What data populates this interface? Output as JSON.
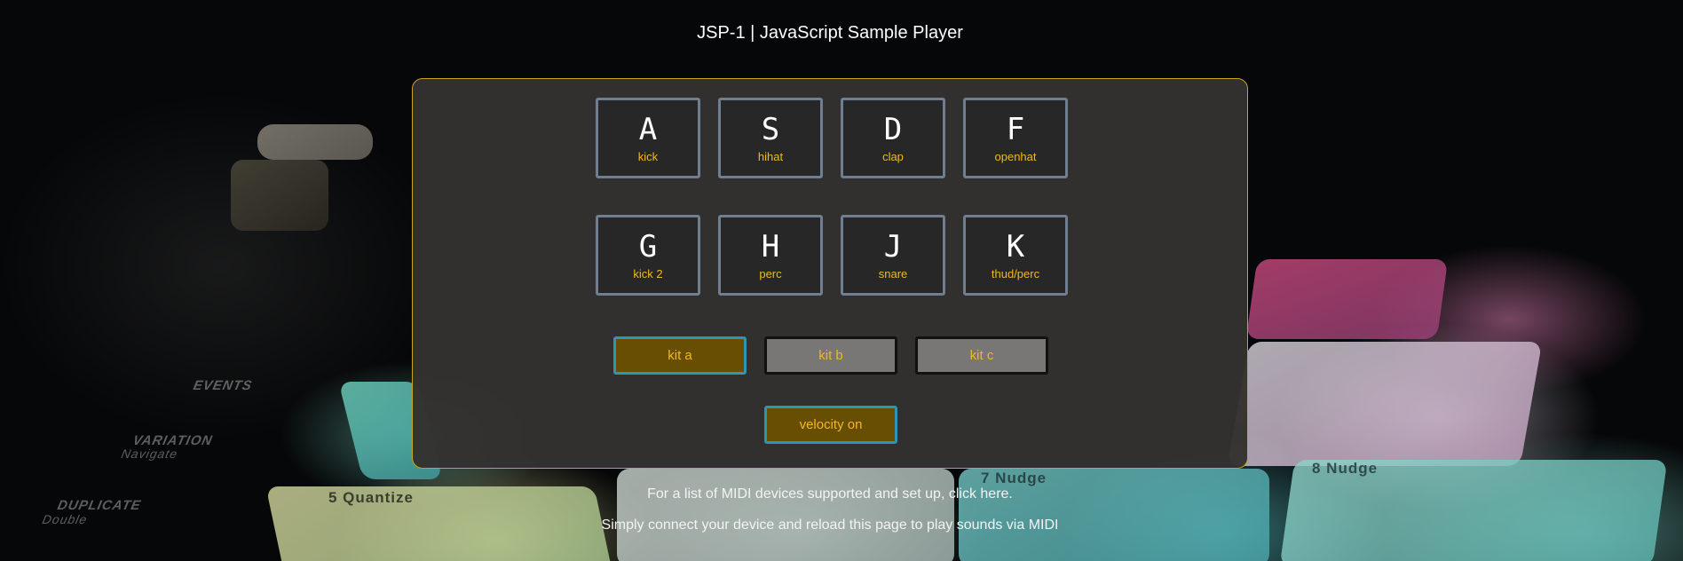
{
  "app": {
    "title": "JSP-1 | JavaScript Sample Player"
  },
  "pads": [
    {
      "key": "A",
      "sample": "kick"
    },
    {
      "key": "S",
      "sample": "hihat"
    },
    {
      "key": "D",
      "sample": "clap"
    },
    {
      "key": "F",
      "sample": "openhat"
    },
    {
      "key": "G",
      "sample": "kick 2"
    },
    {
      "key": "H",
      "sample": "perc"
    },
    {
      "key": "J",
      "sample": "snare"
    },
    {
      "key": "K",
      "sample": "thud/perc"
    }
  ],
  "kits": [
    {
      "label": "kit a",
      "active": true
    },
    {
      "label": "kit b",
      "active": false
    },
    {
      "label": "kit c",
      "active": false
    }
  ],
  "velocity": {
    "label": "velocity on",
    "active": true
  },
  "footer": {
    "midi_prefix": "For a list of MIDI devices supported and set up, ",
    "midi_link": "click here",
    "midi_suffix": ".",
    "connect_note": "Simply connect your device and reload this page to play sounds via MIDI"
  },
  "background": {
    "labels": [
      "5 Quantize",
      "7 Nudge",
      "8 Nudge",
      "EVENTS",
      "VARIATION",
      "Navigate",
      "DUPLICATE",
      "Double"
    ]
  },
  "colors": {
    "accent": "#f1b81f",
    "panel_border": "#c9a21e",
    "pad_border": "#6f7f91",
    "active_button": "#684e02",
    "active_border": "#2d96b4",
    "inactive_button": "#797676"
  }
}
